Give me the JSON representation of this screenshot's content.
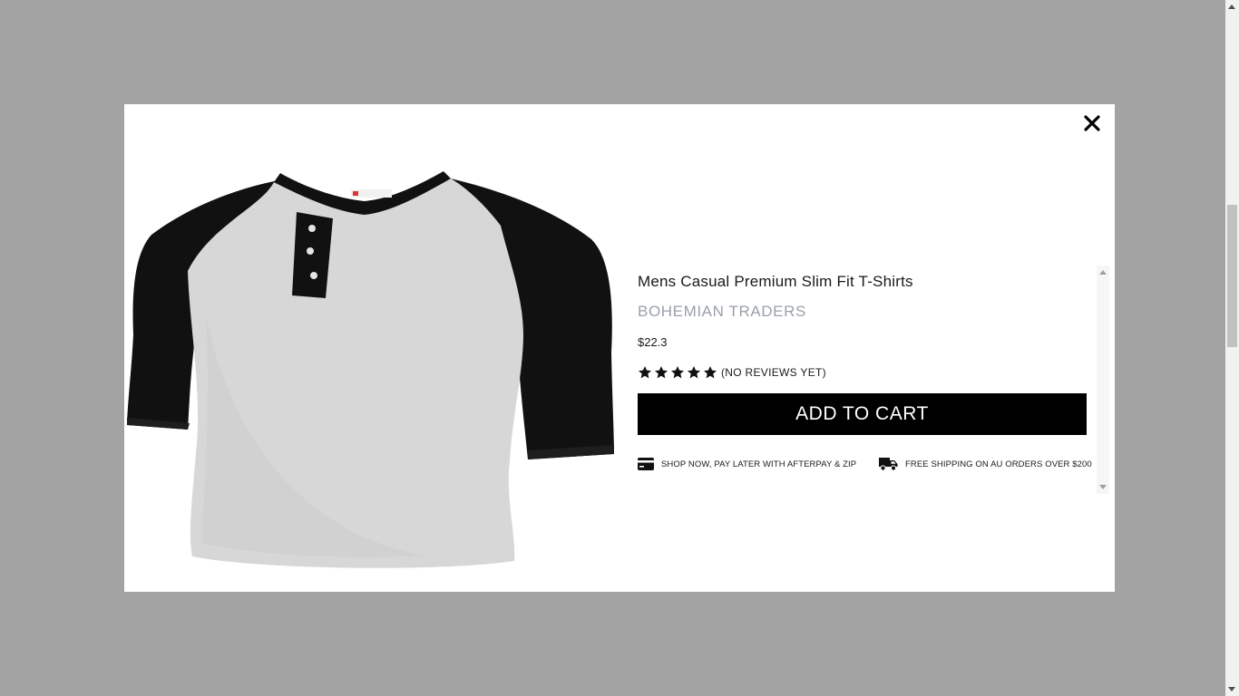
{
  "modal": {
    "close_icon": "close-icon",
    "product_image_alt": "raglan-henley-tshirt"
  },
  "product": {
    "title": "Mens Casual Premium Slim Fit T-Shirts",
    "brand": "BOHEMIAN TRADERS",
    "price": "$22.3",
    "rating_stars": 5,
    "reviews_text": "(NO REVIEWS YET)",
    "add_to_cart_label": "ADD TO CART"
  },
  "perks": [
    {
      "icon": "credit-card-icon",
      "text": "SHOP NOW, PAY LATER WITH AFTERPAY & ZIP"
    },
    {
      "icon": "truck-icon",
      "text": "FREE SHIPPING ON AU ORDERS OVER $200"
    }
  ],
  "colors": {
    "backdrop": "#a3a3a3",
    "button_bg": "#000000",
    "brand_text": "#9aa0aa"
  }
}
